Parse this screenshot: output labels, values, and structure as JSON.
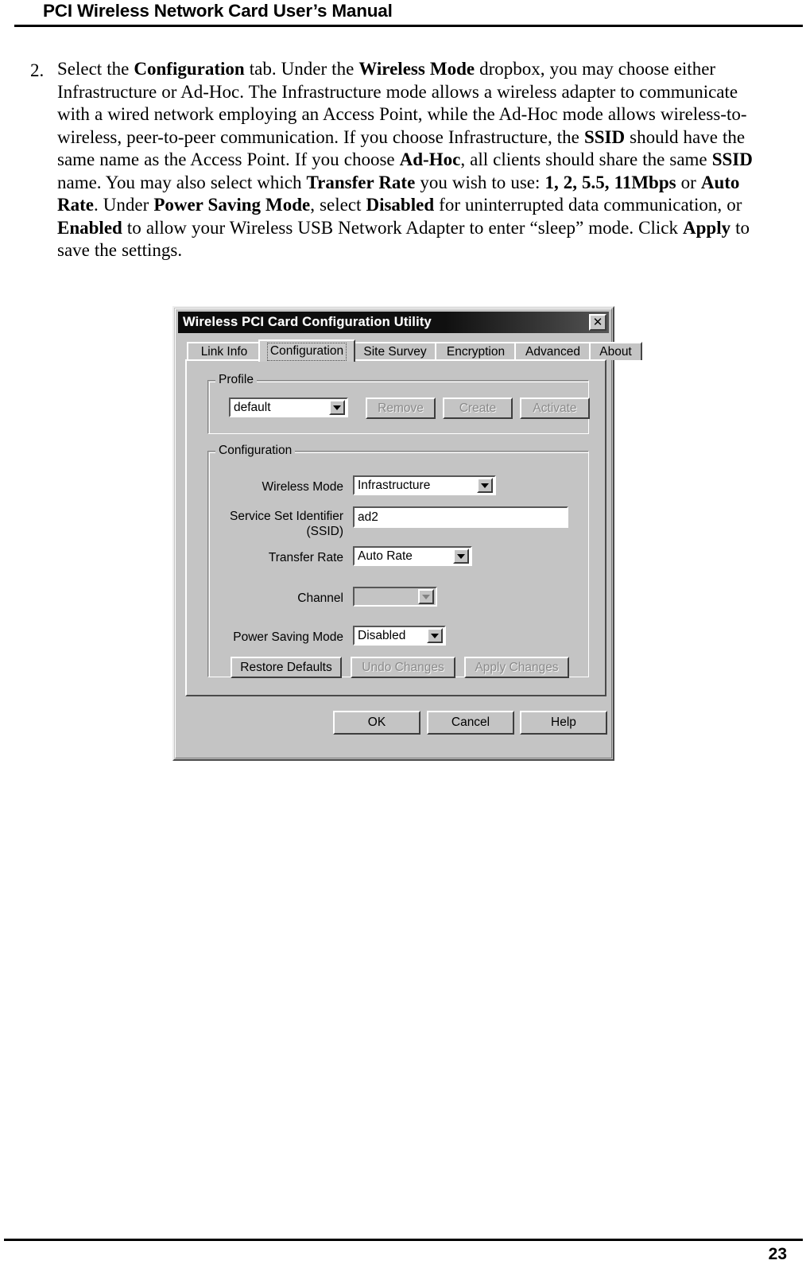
{
  "document": {
    "header_title": "PCI Wireless Network Card User’s Manual",
    "page_number": "23"
  },
  "step": {
    "number": "2.",
    "segments": [
      {
        "text": "Select the ",
        "bold": false
      },
      {
        "text": "Configuration",
        "bold": true
      },
      {
        "text": " tab. Under the ",
        "bold": false
      },
      {
        "text": "Wireless Mode",
        "bold": true
      },
      {
        "text": " dropbox, you may choose either Infrastructure or Ad-Hoc. The Infrastructure mode allows a wireless adapter to communicate with a wired network employing an Access Point, while the Ad-Hoc mode allows wireless-to-wireless, peer-to-peer communication. If you choose Infrastructure, the ",
        "bold": false
      },
      {
        "text": "SSID",
        "bold": true
      },
      {
        "text": " should have the same name as the Access Point. If you choose ",
        "bold": false
      },
      {
        "text": "Ad-Hoc",
        "bold": true
      },
      {
        "text": ", all clients should share the same ",
        "bold": false
      },
      {
        "text": "SSID",
        "bold": true
      },
      {
        "text": " name. You may also select which ",
        "bold": false
      },
      {
        "text": "Transfer Rate",
        "bold": true
      },
      {
        "text": " you wish to use: ",
        "bold": false
      },
      {
        "text": "1, 2, 5.5, 11Mbps",
        "bold": true
      },
      {
        "text": " or ",
        "bold": false
      },
      {
        "text": "Auto Rate",
        "bold": true
      },
      {
        "text": ". Under ",
        "bold": false
      },
      {
        "text": "Power Saving Mode",
        "bold": true
      },
      {
        "text": ", select ",
        "bold": false
      },
      {
        "text": "Disabled",
        "bold": true
      },
      {
        "text": " for uninterrupted data communication, or ",
        "bold": false
      },
      {
        "text": "Enabled",
        "bold": true
      },
      {
        "text": " to allow your Wireless USB Network Adapter to enter “sleep” mode. Click ",
        "bold": false
      },
      {
        "text": "Apply",
        "bold": true
      },
      {
        "text": " to save the settings.",
        "bold": false
      }
    ]
  },
  "dialog": {
    "title": "Wireless PCI Card Configuration Utility",
    "close_label": "✕",
    "tabs": [
      {
        "label": "Link Info",
        "active": false
      },
      {
        "label": "Configuration",
        "active": true
      },
      {
        "label": "Site Survey",
        "active": false
      },
      {
        "label": "Encryption",
        "active": false
      },
      {
        "label": "Advanced",
        "active": false
      },
      {
        "label": "About",
        "active": false
      }
    ],
    "profile_group": {
      "title": "Profile",
      "combo_value": "default",
      "buttons": [
        {
          "label": "Remove",
          "enabled": false
        },
        {
          "label": "Create",
          "enabled": false
        },
        {
          "label": "Activate",
          "enabled": false
        }
      ]
    },
    "configuration_group": {
      "title": "Configuration",
      "fields": {
        "wireless_mode_label": "Wireless Mode",
        "wireless_mode_value": "Infrastructure",
        "ssid_label_line1": "Service Set Identifier",
        "ssid_label_line2": "(SSID)",
        "ssid_value": "ad2",
        "transfer_rate_label": "Transfer Rate",
        "transfer_rate_value": "Auto Rate",
        "channel_label": "Channel",
        "channel_value": "",
        "power_saving_label": "Power Saving Mode",
        "power_saving_value": "Disabled"
      },
      "buttons": [
        {
          "label": "Restore Defaults",
          "enabled": true
        },
        {
          "label": "Undo Changes",
          "enabled": false
        },
        {
          "label": "Apply Changes",
          "enabled": false
        }
      ]
    },
    "dialog_buttons": [
      {
        "label": "OK"
      },
      {
        "label": "Cancel"
      },
      {
        "label": "Help"
      }
    ]
  },
  "colors": {
    "dialog_face": "#c4c4c4",
    "titlebar": "#0b0b0b",
    "titlebar_text": "#ffffff",
    "field_background": "#ffffff",
    "disabled_text": "#8a8a8a",
    "page_background": "#ffffff",
    "ink": "#000000"
  }
}
